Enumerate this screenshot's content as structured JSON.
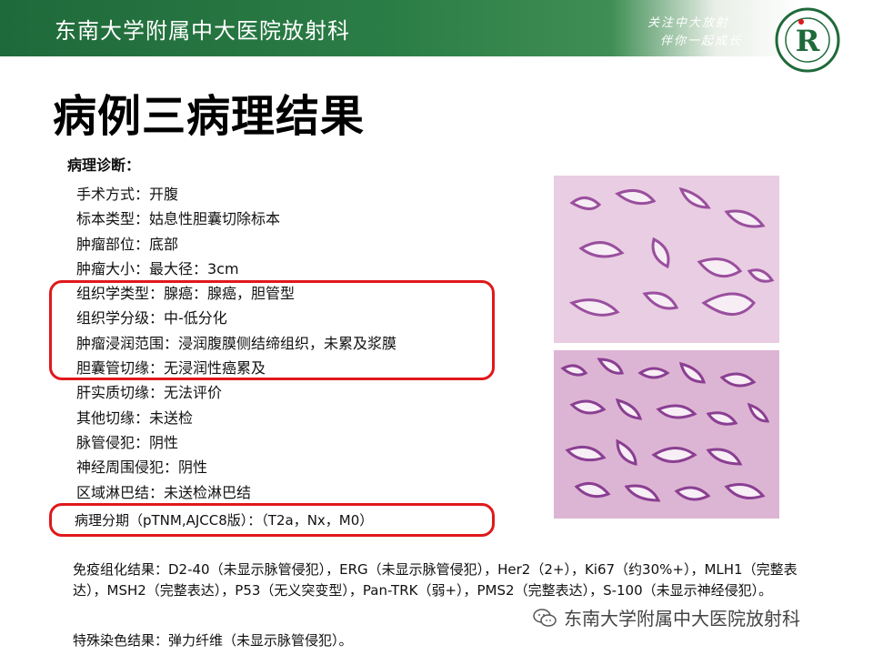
{
  "header": {
    "institution": "东南大学附属中大医院放射科",
    "slogan_line1": "关注中大放射",
    "slogan_line2": "伴你一起成长",
    "logo_letter": "R",
    "banner_color": "#2b7d46"
  },
  "slide": {
    "title": "病例三病理结果",
    "section_label": "病理诊断：",
    "diagnosis": [
      "手术方式：开腹",
      "标本类型：姑息性胆囊切除标本",
      "肿瘤部位：底部",
      "肿瘤大小：最大径：3cm",
      "组织学类型：腺癌：腺癌，胆管型",
      "组织学分级：中-低分化",
      "肿瘤浸润范围：浸润腹膜侧结缔组织，未累及浆膜",
      "胆囊管切缘：无浸润性癌累及",
      "肝实质切缘：无法评价",
      "其他切缘：未送检",
      "脉管侵犯：阴性",
      "神经周围侵犯：阴性",
      "区域淋巴结：未送检淋巴结"
    ],
    "stage": "病理分期（pTNM,AJCC8版）：（T2a，Nx，M0）",
    "ihc": "免疫组化结果：D2-40（未显示脉管侵犯），ERG（未显示脉管侵犯），Her2（2+），Ki67（约30%+），MLH1（完整表达），MSH2（完整表达），P53（无义突变型），Pan-TRK（弱+），PMS2（完整表达），S-100（未显示神经侵犯）。",
    "special_stain": "特殊染色结果：弹力纤维（未显示脉管侵犯）。",
    "highlight_color": "#e0181b"
  },
  "watermark": {
    "text": "东南大学附属中大医院放射科",
    "icon": "wechat-icon"
  }
}
